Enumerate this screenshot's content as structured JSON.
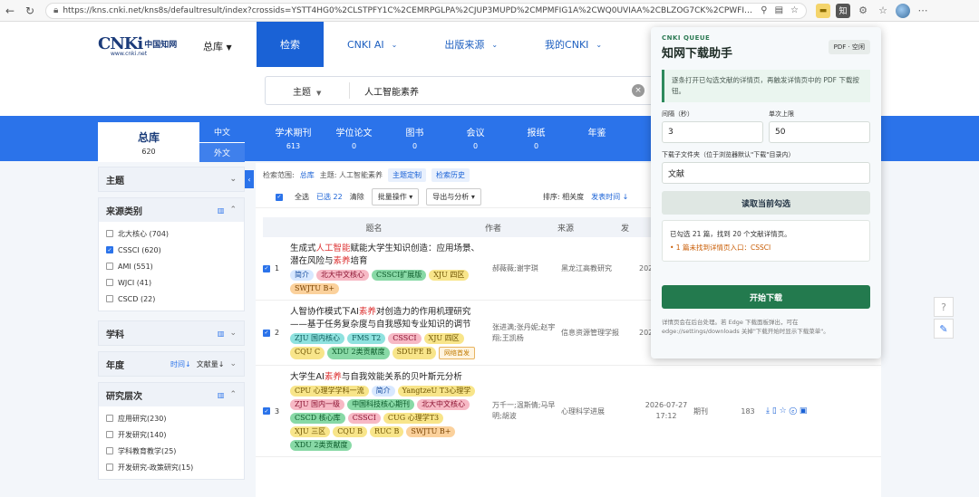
{
  "browser": {
    "url": "https://kns.cnki.net/kns8s/defaultresult/index?crossids=YSTT4HG0%2CLSTPFY1C%2CEMRPGLPA%2CJUP3MUPD%2CMPMFIG1A%2CWQ0UVIAA%2CBLZOG7CK%2CPWFIRAGL%2...",
    "ext_zhi": "知"
  },
  "header": {
    "logo_en": "CNKi",
    "logo_cn": "中国知网",
    "logo_sub": "www.cnki.net",
    "db": "总库",
    "nav": [
      {
        "label": "检索"
      },
      {
        "label": "CNKI AI"
      },
      {
        "label": "出版来源"
      },
      {
        "label": "我的CNKI"
      }
    ]
  },
  "search": {
    "field": "主题",
    "value": "人工智能素养"
  },
  "categories": {
    "main_label": "总库",
    "main_count": "620",
    "lang_cn": "中文",
    "lang_foreign": "外文",
    "items": [
      {
        "label": "学术期刊",
        "count": "613"
      },
      {
        "label": "学位论文",
        "count": "0"
      },
      {
        "label": "图书",
        "count": "0"
      },
      {
        "label": "会议",
        "count": "0"
      },
      {
        "label": "报纸",
        "count": "0"
      },
      {
        "label": "年鉴",
        "count": ""
      }
    ]
  },
  "sidebar": {
    "topic": "主题",
    "source_type": "来源类别",
    "sources": [
      {
        "label": "北大核心 (704)",
        "checked": false
      },
      {
        "label": "CSSCI (620)",
        "checked": true
      },
      {
        "label": "AMI (551)",
        "checked": false
      },
      {
        "label": "WJCI (41)",
        "checked": false
      },
      {
        "label": "CSCD (22)",
        "checked": false
      }
    ],
    "subject": "学科",
    "year": "年度",
    "year_tool1": "时间↓",
    "year_tool2": "文献量↓",
    "level": "研究层次",
    "levels": [
      {
        "label": "应用研究(230)"
      },
      {
        "label": "开发研究(140)"
      },
      {
        "label": "学科教育教学(25)"
      },
      {
        "label": "开发研究-政策研究(15)"
      }
    ]
  },
  "results": {
    "scope_label": "检索范围:",
    "scope_db": "总库",
    "scope_topic": "主题: 人工智能素养",
    "scope_btn1": "主题定制",
    "scope_btn2": "检索历史",
    "select_all": "全选",
    "selected": "已选 22",
    "clear": "清除",
    "bulk": "批量操作 ▾",
    "export": "导出与分析 ▾",
    "sort": "排序: 相关度",
    "sort2": "发表时间 ↓",
    "col_title": "题名",
    "col_author": "作者",
    "col_source": "来源",
    "col_date": "发",
    "rows": [
      {
        "num": "1",
        "title_pre": "生成式",
        "title_em1": "人工智能",
        "title_mid": "赋能大学生知识创造：应用场景、潜在风险与",
        "title_em2": "素养",
        "title_post": "培育",
        "tags": [
          {
            "t": "简介",
            "c": "blue"
          },
          {
            "t": "北大中文核心",
            "c": "pink"
          },
          {
            "t": "CSSCI扩展版",
            "c": "green"
          },
          {
            "t": "XJU 四区",
            "c": "yellow"
          },
          {
            "t": "SWJTU B+",
            "c": "orange"
          }
        ],
        "authors": "郝薇薇;谢宇琪",
        "source": "黑龙江高教研究",
        "date": "202",
        "type": "",
        "downloads": "",
        "ops": ""
      },
      {
        "num": "2",
        "title_pre": "人智协作模式下AI",
        "title_em1": "素养",
        "title_mid": "对创造力的作用机理研究——基于任务复杂度与自我感知专业知识的调节",
        "title_em2": "",
        "title_post": "",
        "tags": [
          {
            "t": "ZJU 国内核心",
            "c": "teal"
          },
          {
            "t": "FMS T2",
            "c": "teal"
          },
          {
            "t": "CSSCI",
            "c": "pink"
          },
          {
            "t": "XJU 四区",
            "c": "yellow"
          },
          {
            "t": "CQU C",
            "c": "yellow"
          },
          {
            "t": "XDU 2类贡献度",
            "c": "green"
          },
          {
            "t": "SDUFE B",
            "c": "yellow"
          },
          {
            "t": "网络首发",
            "c": "note"
          }
        ],
        "authors": "张进满;张丹妮;赵宇翔;王凯杨",
        "source": "信息资源管理学报",
        "date": "202",
        "type": "",
        "downloads": "",
        "ops": ""
      },
      {
        "num": "3",
        "title_pre": "大学生AI",
        "title_em1": "素养",
        "title_mid": "与自我效能关系的贝叶斯元分析",
        "title_em2": "",
        "title_post": "",
        "tags": [
          {
            "t": "CPU 心理学学科一流",
            "c": "yellow"
          },
          {
            "t": "简介",
            "c": "blue"
          },
          {
            "t": "YangtzeU T3心理学",
            "c": "yellow"
          },
          {
            "t": "ZJU 国内一级",
            "c": "pink"
          },
          {
            "t": "中国科技核心期刊",
            "c": "green"
          },
          {
            "t": "北大中文核心",
            "c": "pink"
          },
          {
            "t": "CSCD 核心库",
            "c": "green"
          },
          {
            "t": "CSSCI",
            "c": "pink"
          },
          {
            "t": "CUG 心理学T3",
            "c": "yellow"
          },
          {
            "t": "XJU 三区",
            "c": "yellow"
          },
          {
            "t": "CQU B",
            "c": "yellow"
          },
          {
            "t": "RUC B",
            "c": "yellow"
          },
          {
            "t": "SWJTU B+",
            "c": "orange"
          },
          {
            "t": "XDU 2类贡献度",
            "c": "green"
          }
        ],
        "authors": "万千一;温斯倩;马早明;胡波",
        "source": "心理科学进展",
        "date": "2026-07-27 17:12",
        "type": "期刊",
        "downloads": "183",
        "ops": "⤓ ▯ ☆ ⓔ ▣"
      }
    ]
  },
  "popup": {
    "kicker": "CNKI QUEUE",
    "title": "知网下载助手",
    "badge": "PDF · 空闲",
    "info": "逐条打开已勾选文献的详情页，再触发详情页中的 PDF 下载按钮。",
    "interval_label": "间隔（秒）",
    "interval_value": "3",
    "limit_label": "单次上限",
    "limit_value": "50",
    "folder_label": "下载子文件夹（位于浏览器默认\"下载\"目录内）",
    "folder_value": "文献",
    "read_btn": "读取当前勾选",
    "result_line": "已勾选 21 篇，找到 20 个文献详情页。",
    "result_warn": "• 1 篇未找到详情页入口：CSSCI",
    "start_btn": "开始下载",
    "footer": "详情页会在后台处理。若 Edge 下载面板弹出，可在 edge://settings/downloads 关掉\"下载开始时显示下载菜单\"。"
  },
  "colors": {
    "primary": "#2b73ea",
    "popup_green": "#237a4e"
  }
}
